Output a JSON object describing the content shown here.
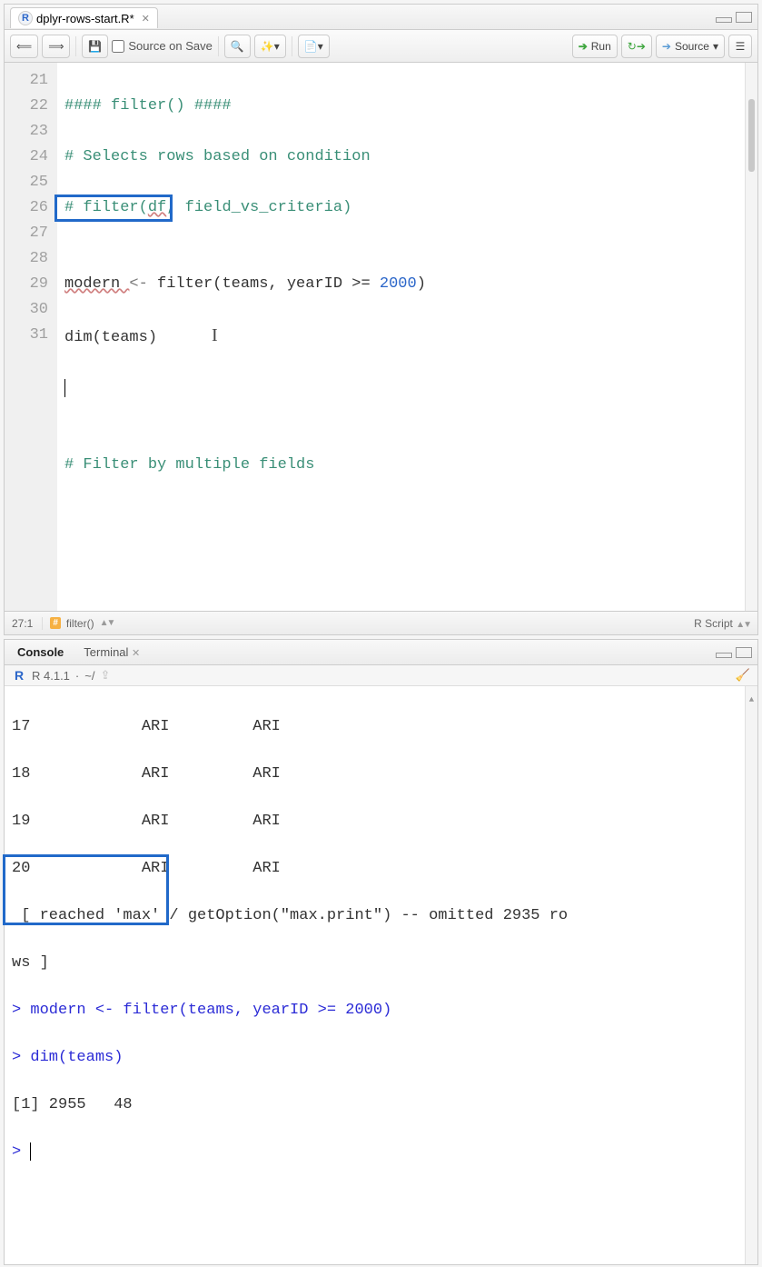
{
  "editor": {
    "tab": {
      "title": "dplyr-rows-start.R*",
      "icon": "r-file-icon"
    },
    "toolbar": {
      "source_on_save_label": "Source on Save",
      "run_label": "Run",
      "source_label": "Source"
    },
    "gutter": [
      "21",
      "22",
      "23",
      "24",
      "25",
      "26",
      "27",
      "28",
      "29",
      "30",
      "31"
    ],
    "lines": {
      "l21_a": "#### filter() ####",
      "l22_a": "# Selects rows based on condition",
      "l23_a": "# filter(",
      "l23_b": "df",
      "l23_c": ", field_vs_criteria)",
      "l24": "",
      "l25_a": "modern ",
      "l25_b": "<-",
      "l25_c": " filter(teams, yearID >= ",
      "l25_d": "2000",
      "l25_e": ")",
      "l26_a": "dim(teams)",
      "l27": "",
      "l28": "",
      "l29_a": "# Filter by multiple fields",
      "l30": "",
      "l31": ""
    },
    "status": {
      "position": "27:1",
      "section": "filter()",
      "filetype": "R Script"
    }
  },
  "console": {
    "tabs": {
      "console": "Console",
      "terminal": "Terminal"
    },
    "sub": {
      "version": "R 4.1.1",
      "path": "~/"
    },
    "lines": {
      "r17": "17            ARI         ARI",
      "r18": "18            ARI         ARI",
      "r19": "19            ARI         ARI",
      "r20": "20            ARI         ARI",
      "rlimit_a": " [ reached 'max' / getOption(\"max.print\") -- omitted 2935 ro",
      "rlimit_b": "ws ]",
      "cmd1_prompt": "> ",
      "cmd1": "modern <- filter(teams, yearID >= 2000)",
      "cmd2_prompt": "> ",
      "cmd2": "dim(teams)",
      "out1": "[1] 2955   48",
      "cmd3_prompt": "> "
    }
  }
}
